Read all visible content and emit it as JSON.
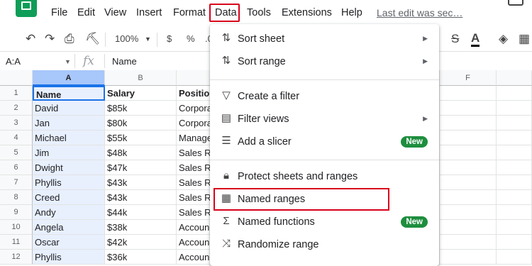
{
  "menubar": {
    "items": [
      "File",
      "Edit",
      "View",
      "Insert",
      "Format",
      "Data",
      "Tools",
      "Extensions",
      "Help"
    ],
    "last_edit": "Last edit was sec…"
  },
  "toolbar": {
    "zoom": "100%",
    "currency": "$",
    "percent": "%",
    "decimal": ".0"
  },
  "formula_bar": {
    "name_box": "A:A",
    "fx": "fx",
    "formula": "Name"
  },
  "grid": {
    "columns": [
      "A",
      "B",
      "F"
    ],
    "row_numbers": [
      "1",
      "2",
      "3",
      "4",
      "5",
      "6",
      "7",
      "8",
      "9",
      "10",
      "11",
      "12"
    ],
    "rows": [
      [
        "Name",
        "Salary",
        "Positio"
      ],
      [
        "David",
        "$85k",
        "Corpora"
      ],
      [
        "Jan",
        "$80k",
        "Corpora"
      ],
      [
        "Michael",
        "$55k",
        "Manage"
      ],
      [
        "Jim",
        "$48k",
        "Sales R"
      ],
      [
        "Dwight",
        "$47k",
        "Sales R"
      ],
      [
        "Phyllis",
        "$43k",
        "Sales R"
      ],
      [
        "Creed",
        "$43k",
        "Sales R"
      ],
      [
        "Andy",
        "$44k",
        "Sales R"
      ],
      [
        "Angela",
        "$38k",
        "Accoun"
      ],
      [
        "Oscar",
        "$42k",
        "Accoun"
      ],
      [
        "Phyllis",
        "$36k",
        "Accoun"
      ]
    ]
  },
  "data_menu": {
    "items": [
      {
        "label": "Sort sheet",
        "icon": "sort-icon",
        "submenu": true
      },
      {
        "label": "Sort range",
        "icon": "sort-icon",
        "submenu": true
      },
      {
        "label": "Create a filter",
        "icon": "filter-icon"
      },
      {
        "label": "Filter views",
        "icon": "filter-views-icon",
        "submenu": true
      },
      {
        "label": "Add a slicer",
        "icon": "slicer-icon",
        "badge": "New"
      },
      {
        "label": "Protect sheets and ranges",
        "icon": "lock-icon"
      },
      {
        "label": "Named ranges",
        "icon": "named-ranges-icon"
      },
      {
        "label": "Named functions",
        "icon": "sigma-icon",
        "badge": "New"
      },
      {
        "label": "Randomize range",
        "icon": "shuffle-icon"
      }
    ]
  },
  "colors": {
    "highlight": "#d9001b",
    "badge": "#1e8e3e",
    "selection": "#e8f0fe"
  }
}
